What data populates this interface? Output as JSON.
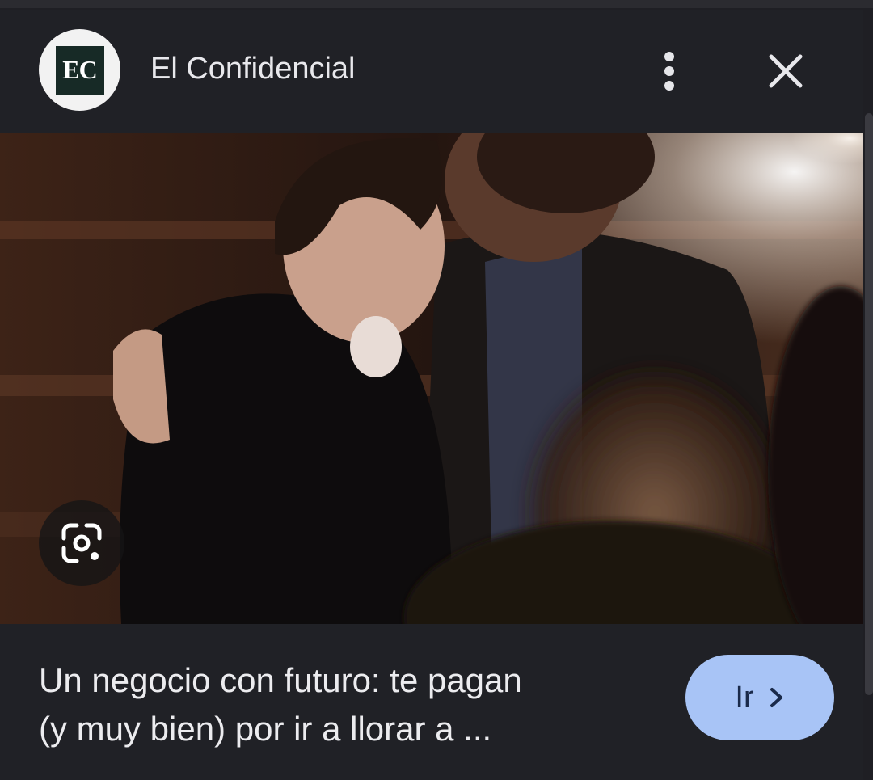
{
  "header": {
    "logo_text": "EC",
    "publisher": "El Confidencial",
    "more_icon": "more-vert-icon",
    "close_icon": "close-icon"
  },
  "image": {
    "lens_icon": "google-lens-icon"
  },
  "article": {
    "headline_line1": "Un negocio con futuro: te pagan",
    "headline_line2": "(y muy bien) por ir a llorar a ...",
    "go_label": "Ir",
    "go_icon": "chevron-right-icon"
  },
  "colors": {
    "background": "#202126",
    "button": "#a8c4f6",
    "logo_bg": "#172a26"
  }
}
